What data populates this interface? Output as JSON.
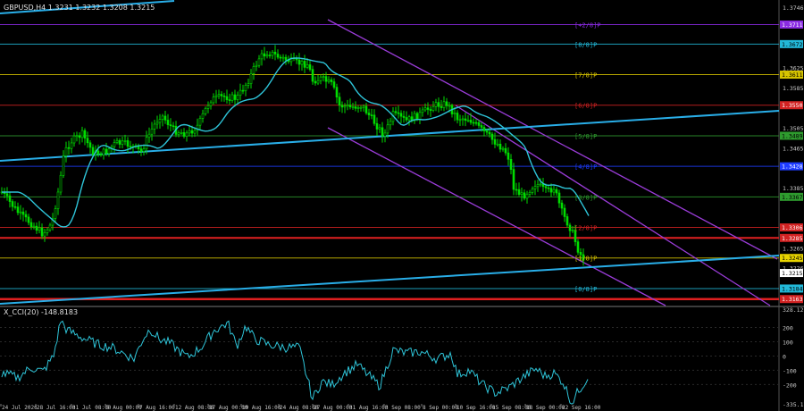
{
  "header": {
    "symbol_line": "GBPUSD,H4  1.3231 1.3232 1.3208 1.3215",
    "indicator_line": "X_CCI(20) -148.8183"
  },
  "price_axis": {
    "ticks": [
      "1.3746",
      "1.3625",
      "1.3585",
      "1.3505",
      "1.3465",
      "1.3385",
      "1.3305",
      "1.3265",
      "1.3226"
    ],
    "boxes": [
      {
        "label": "1.3711",
        "bg": "#8a2be2",
        "fg": "#ffffff"
      },
      {
        "label": "1.3672",
        "bg": "#22b8d8",
        "fg": "#000000"
      },
      {
        "label": "1.3611",
        "bg": "#d6c400",
        "fg": "#000000"
      },
      {
        "label": "1.3550",
        "bg": "#d22222",
        "fg": "#ffffff"
      },
      {
        "label": "1.3489",
        "bg": "#2e9b2e",
        "fg": "#000000"
      },
      {
        "label": "1.3428",
        "bg": "#1e3cff",
        "fg": "#ffffff"
      },
      {
        "label": "1.3367",
        "bg": "#2e9b2e",
        "fg": "#000000"
      },
      {
        "label": "1.3306",
        "bg": "#d22222",
        "fg": "#ffffff"
      },
      {
        "label": "1.3285",
        "bg": "#d22222",
        "fg": "#ffffff"
      },
      {
        "label": "1.3245",
        "bg": "#e8d400",
        "fg": "#000000"
      },
      {
        "label": "1.3215",
        "bg": "#ffffff",
        "fg": "#000000"
      },
      {
        "label": "1.3184",
        "bg": "#22b8d8",
        "fg": "#000000"
      },
      {
        "label": "1.3163",
        "bg": "#d22222",
        "fg": "#ffffff"
      }
    ]
  },
  "murrey_labels": [
    {
      "label": "[+2/8]P",
      "color": "#8a2be2"
    },
    {
      "label": "[8/8]P",
      "color": "#22b8d8"
    },
    {
      "label": "[7/8]P",
      "color": "#d6c400"
    },
    {
      "label": "[6/8]P",
      "color": "#d22222"
    },
    {
      "label": "[5/8]P",
      "color": "#2e9b2e"
    },
    {
      "label": "[4/8]P",
      "color": "#1e3cff"
    },
    {
      "label": "[3/8]P",
      "color": "#2e9b2e"
    },
    {
      "label": "[2/8]P",
      "color": "#d22222"
    },
    {
      "label": "[1/8]P",
      "color": "#d6c400"
    },
    {
      "label": "[0/8]P",
      "color": "#22b8d8"
    }
  ],
  "cci_axis": [
    "328.1256",
    "200",
    "100",
    "0",
    "-100",
    "-200",
    "-335.1745"
  ],
  "time_axis": [
    "24 Jul 2026",
    "28 Jul 16:00",
    "31 Jul 08:00",
    "5 Aug 00:00",
    "7 Aug 16:00",
    "12 Aug 08:00",
    "17 Aug 00:00",
    "19 Aug 16:00",
    "24 Aug 08:00",
    "27 Aug 00:00",
    "31 Aug 16:00",
    "3 Sep 08:00",
    "8 Sep 00:00",
    "10 Sep 16:00",
    "15 Sep 08:00",
    "18 Sep 00:00",
    "22 Sep 16:00"
  ],
  "colors": {
    "candle": "#00dd00",
    "ma": "#2ec4d8",
    "trend": "#29aee8",
    "channel": "#9a3cd8",
    "cci": "#2ec4d8",
    "axis_text": "#c8c8c8",
    "grid": "#1a1a1a"
  }
}
